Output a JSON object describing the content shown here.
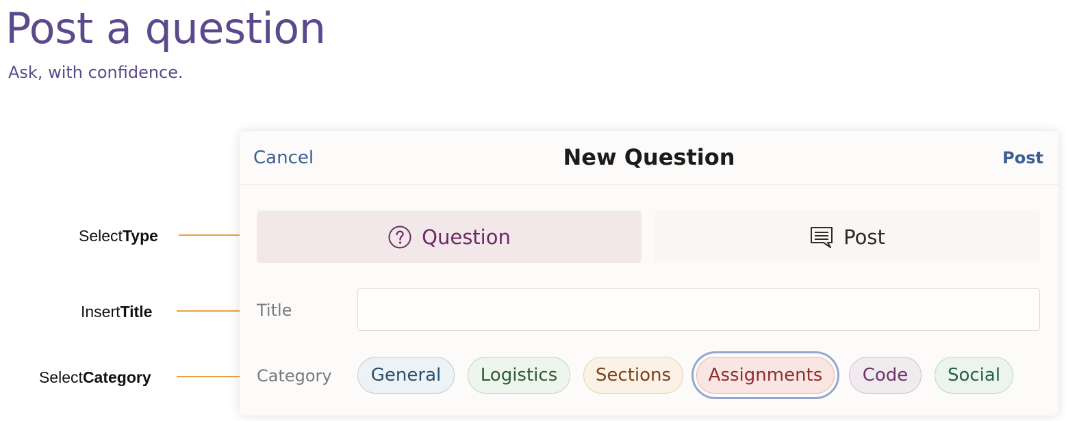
{
  "hero": {
    "title": "Post a question",
    "subtitle": "Ask, with confidence."
  },
  "callouts": [
    {
      "prefix": "Select ",
      "bold": "Type"
    },
    {
      "prefix": "Insert ",
      "bold": "Title"
    },
    {
      "prefix": "Select ",
      "bold": "Category"
    }
  ],
  "header": {
    "cancel_label": "Cancel",
    "title": "New Question",
    "post_label": "Post"
  },
  "type_selector": {
    "options": [
      {
        "label": "Question",
        "icon": "question-circle-icon",
        "selected": true
      },
      {
        "label": "Post",
        "icon": "speech-bubble-icon",
        "selected": false
      }
    ]
  },
  "title_field": {
    "label": "Title",
    "value": "",
    "placeholder": ""
  },
  "category_field": {
    "label": "Category",
    "selected": "Assignments",
    "chips": [
      {
        "label": "General",
        "bg": "#edf2f5",
        "border": "#b9cbd6",
        "color": "#274f72"
      },
      {
        "label": "Logistics",
        "bg": "#eef5ec",
        "border": "#bcd7bd",
        "color": "#2d5c36"
      },
      {
        "label": "Sections",
        "bg": "#fbf1e6",
        "border": "#e8d1ae",
        "color": "#7a4218"
      },
      {
        "label": "Assignments",
        "bg": "#f9e6e3",
        "border": "#e2b8b2",
        "color": "#8c2f2b"
      },
      {
        "label": "Code",
        "bg": "#f1ebf0",
        "border": "#cdbfcc",
        "color": "#6b356b"
      },
      {
        "label": "Social",
        "bg": "#ecf4f0",
        "border": "#bbd7cc",
        "color": "#24604a"
      }
    ]
  },
  "colors": {
    "brand_purple": "#5b4a8b",
    "link_blue": "#3b5f93",
    "callout_line": "#e9a23b",
    "selected_ring": "#93a7cf"
  }
}
